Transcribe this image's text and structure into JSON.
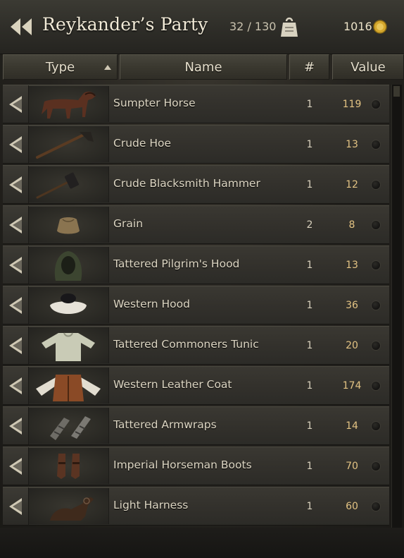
{
  "header": {
    "title": "Reykander’s Party",
    "capacity": "32 / 130",
    "gold": "1016",
    "back_icon": "double-left-arrow-icon",
    "weight_icon": "weight-icon",
    "gold_icon": "gold-coin-icon",
    "colors": {
      "title": "#f1ead7",
      "value_text": "#e3c383",
      "coin": "#d4a72c"
    }
  },
  "columns": {
    "type": "Type",
    "name": "Name",
    "count": "#",
    "value": "Value",
    "sort_column": "type",
    "sort_direction": "ascending"
  },
  "items": [
    {
      "name": "Sumpter Horse",
      "count": "1",
      "value": "119",
      "icon": "horse-icon"
    },
    {
      "name": "Crude Hoe",
      "count": "1",
      "value": "13",
      "icon": "hoe-icon"
    },
    {
      "name": "Crude Blacksmith Hammer",
      "count": "1",
      "value": "12",
      "icon": "hammer-icon"
    },
    {
      "name": "Grain",
      "count": "2",
      "value": "8",
      "icon": "grain-sack-icon"
    },
    {
      "name": "Tattered Pilgrim's Hood",
      "count": "1",
      "value": "13",
      "icon": "hood-icon"
    },
    {
      "name": "Western Hood",
      "count": "1",
      "value": "36",
      "icon": "western-hood-icon"
    },
    {
      "name": "Tattered Commoners Tunic",
      "count": "1",
      "value": "20",
      "icon": "tunic-icon"
    },
    {
      "name": "Western Leather Coat",
      "count": "1",
      "value": "174",
      "icon": "leather-coat-icon"
    },
    {
      "name": "Tattered Armwraps",
      "count": "1",
      "value": "14",
      "icon": "armwraps-icon"
    },
    {
      "name": "Imperial Horseman Boots",
      "count": "1",
      "value": "70",
      "icon": "boots-icon"
    },
    {
      "name": "Light Harness",
      "count": "1",
      "value": "60",
      "icon": "harness-icon"
    }
  ]
}
